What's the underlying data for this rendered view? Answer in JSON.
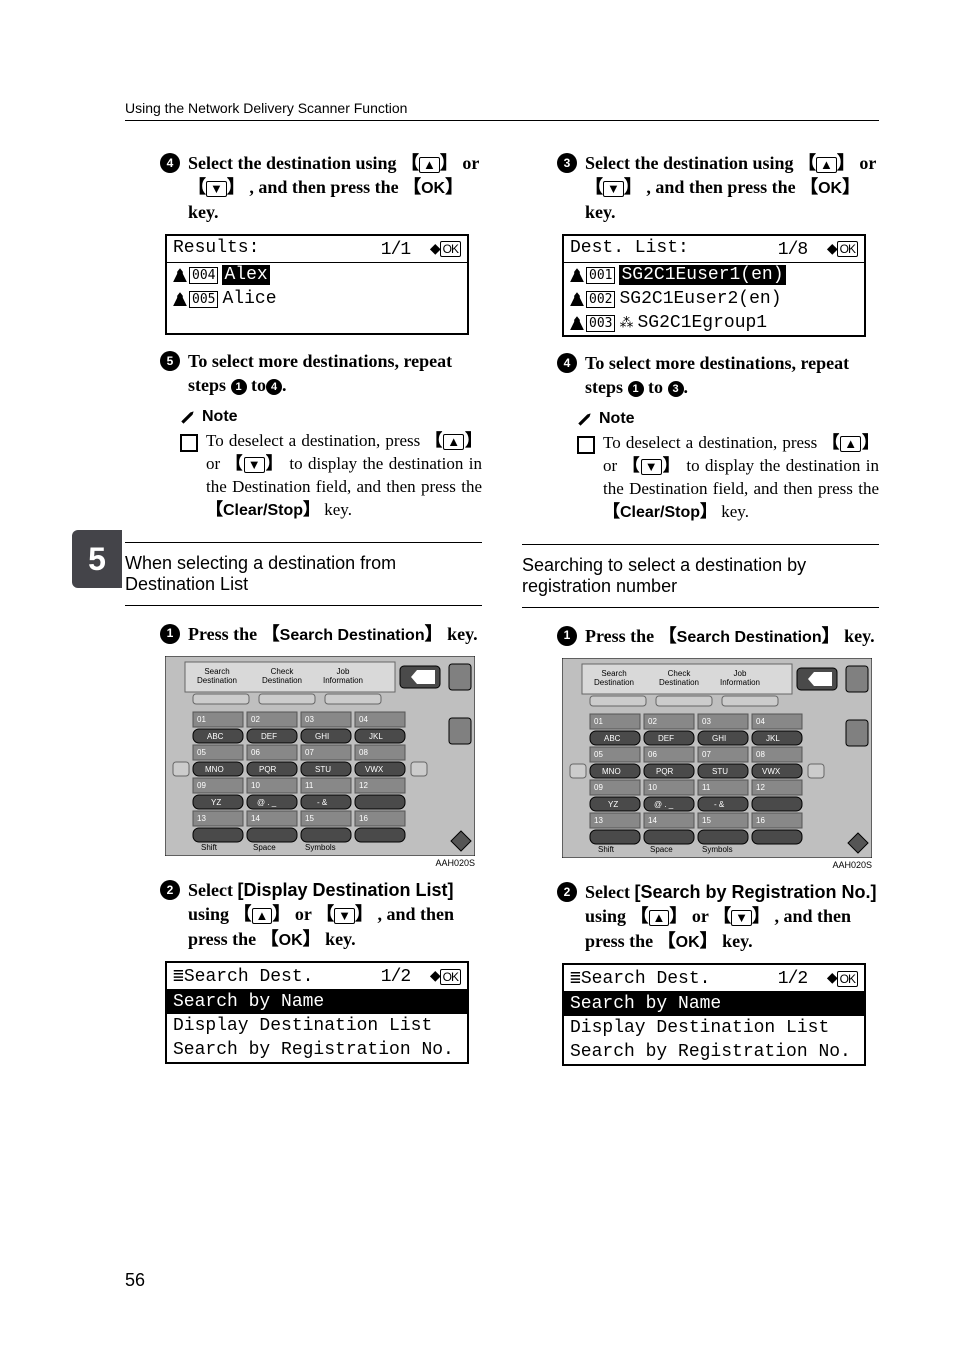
{
  "running_head": "Using the Network Delivery Scanner Function",
  "side_tab": "5",
  "page_number": "56",
  "left": {
    "step4": {
      "num": "4",
      "text_a": "Select the destination using ",
      "text_b": " or ",
      "text_c": ", and then press the ",
      "ok": "OK",
      "text_d": " key."
    },
    "lcd1": {
      "title": "Results:",
      "counter": "1/1",
      "ok": "OK",
      "rows": [
        {
          "code": "004",
          "name": "Alex",
          "hi": true
        },
        {
          "code": "005",
          "name": "Alice",
          "hi": false
        }
      ]
    },
    "step5": {
      "num": "5",
      "text_a": "To select more destinations, repeat steps ",
      "n1": "1",
      "mid": " to",
      "n2": "4",
      "end": "."
    },
    "note": {
      "head": "Note",
      "body_a": "To deselect a destination, press ",
      "body_b": " or ",
      "body_c": " to display the destination in the Destination field, and then press the ",
      "clear": "Clear/Stop",
      "body_d": " key."
    },
    "subhead": "When selecting a destination from Destination List",
    "step1": {
      "num": "1",
      "text_a": "Press the ",
      "key": "Search Destination",
      "text_b": " key."
    },
    "keypad": {
      "top": [
        "Search Destination",
        "Check Destination",
        "Job Information"
      ],
      "fig_code": "AAH020S"
    },
    "step2": {
      "num": "2",
      "text_a": "Select ",
      "opt": "[Display Destination List]",
      "text_b": " using ",
      "text_c": " or ",
      "text_d": ", and then press the ",
      "ok": "OK",
      "text_e": " key."
    },
    "search": {
      "title_icon": "≣",
      "title": "Search Dest.",
      "counter": "1/2",
      "ok": "OK",
      "rows": [
        {
          "t": "Search by Name",
          "hi": true
        },
        {
          "t": "Display Destination List",
          "hi": false
        },
        {
          "t": "Search by Registration No.",
          "hi": false
        }
      ]
    }
  },
  "right": {
    "step3": {
      "num": "3",
      "text_a": "Select the destination using ",
      "text_b": " or ",
      "text_c": ", and then press the ",
      "ok": "OK",
      "text_d": " key."
    },
    "lcd1": {
      "title": "Dest. List:",
      "counter": "1/8",
      "ok": "OK",
      "rows": [
        {
          "code": "001",
          "name": "SG2C1Euser1(en)",
          "hi": true
        },
        {
          "code": "002",
          "name": "SG2C1Euser2(en)",
          "hi": false
        },
        {
          "code": "003",
          "name": "SG2C1Egroup1",
          "hi": false,
          "group": true
        }
      ]
    },
    "step4": {
      "num": "4",
      "text_a": "To select more destinations, repeat steps ",
      "n1": "1",
      "mid": " to ",
      "n2": "3",
      "end": "."
    },
    "note": {
      "head": "Note",
      "body_a": "To deselect a destination, press ",
      "body_b": " or ",
      "body_c": " to display the destination in the Destination field, and then press the ",
      "clear": "Clear/Stop",
      "body_d": " key."
    },
    "subhead": "Searching to select a destination by registration number",
    "step1": {
      "num": "1",
      "text_a": "Press the ",
      "key": "Search Destination",
      "text_b": " key."
    },
    "keypad": {
      "fig_code": "AAH020S"
    },
    "step2": {
      "num": "2",
      "text_a": "Select ",
      "opt": "[Search by Registration No.]",
      "text_b": " using ",
      "text_c": " or ",
      "text_d": ", and then press the ",
      "ok": "OK",
      "text_e": " key."
    },
    "search": {
      "title_icon": "≣",
      "title": "Search Dest.",
      "counter": "1/2",
      "ok": "OK",
      "rows": [
        {
          "t": "Search by Name",
          "hi": true
        },
        {
          "t": "Display Destination List",
          "hi": false
        },
        {
          "t": "Search by Registration No.",
          "hi": false
        }
      ]
    }
  }
}
